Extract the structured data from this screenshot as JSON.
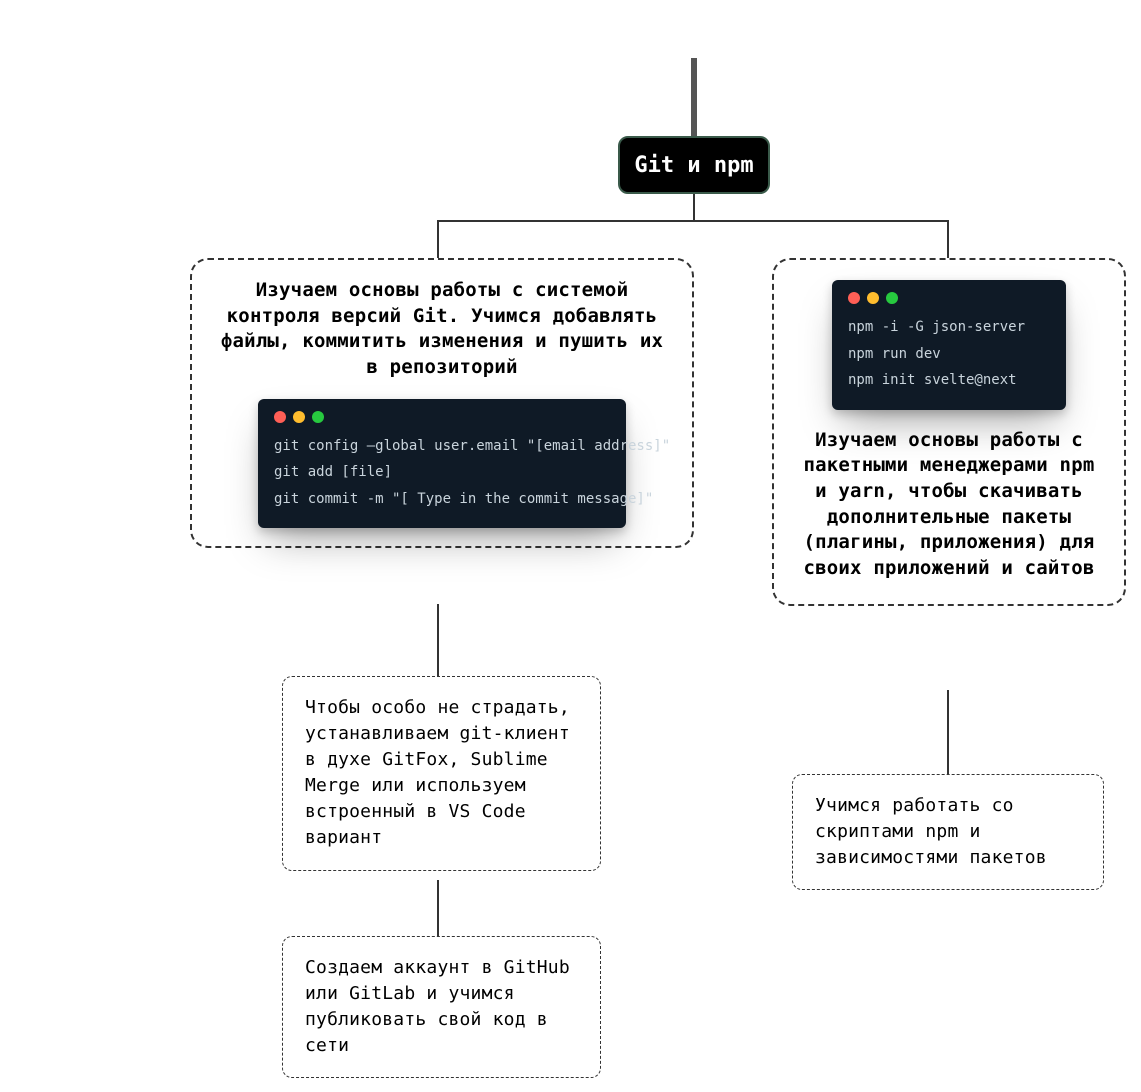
{
  "root": {
    "label": "Git и npm"
  },
  "left": {
    "title": "Изучаем основы работы с системой контроля версий Git. Учимся добавлять файлы, коммитить изменения и пушить их в репозиторий",
    "terminal": {
      "lines": [
        "git config —global user.email \"[email address]\"",
        "git add [file]",
        "git commit -m \"[ Type in the commit message]\""
      ]
    },
    "child1": "Чтобы особо не страдать, устанавливаем git-клиент в духе GitFox, Sublime Merge или используем встроенный в VS Code вариант",
    "child2": "Создаем аккаунт в GitHub или GitLab и учимся публиковать свой код в сети"
  },
  "right": {
    "terminal": {
      "lines": [
        "npm -i -G json-server",
        "npm run dev",
        "npm init svelte@next"
      ]
    },
    "title": "Изучаем основы работы с пакетными менеджерами npm и yarn, чтобы скачивать дополнительные пакеты (плагины, приложения) для своих приложений и сайтов",
    "child1": "Учимся работать со скриптами npm и зависимостями пакетов"
  }
}
